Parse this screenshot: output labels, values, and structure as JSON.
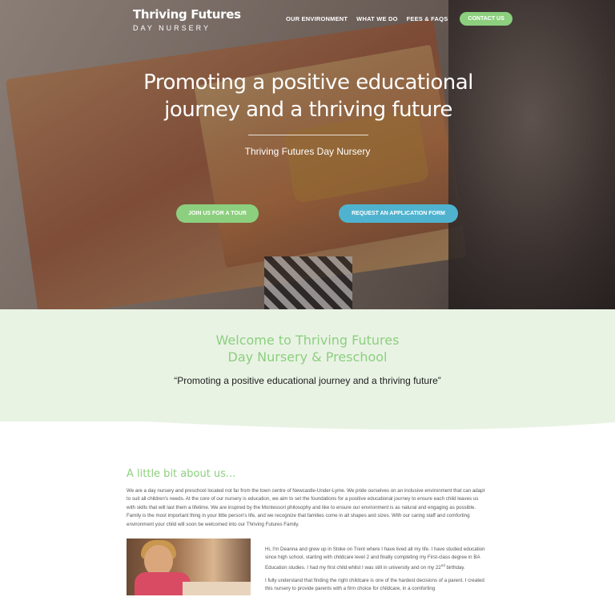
{
  "brand": {
    "name": "Thriving Futures",
    "tagline": "DAY NURSERY"
  },
  "nav": {
    "items": [
      "OUR ENVIRONMENT",
      "WHAT WE DO",
      "FEES & FAQS"
    ],
    "contact_label": "CONTACT US"
  },
  "hero": {
    "title_line1": "Promoting a positive educational",
    "title_line2": "journey and a thriving future",
    "subtitle": "Thriving Futures Day Nursery",
    "tour_button": "JOIN US FOR A TOUR",
    "apply_button": "REQUEST AN APPLICATION FORM"
  },
  "welcome": {
    "title_line1": "Welcome to Thriving Futures",
    "title_line2": "Day Nursery & Preschool",
    "quote": "“Promoting a positive educational journey and a thriving future”"
  },
  "about": {
    "title": "A little bit about us...",
    "body": "We are a day nursery and preschool located not far from the town centre of Newcastle-Under-Lyme. We pride ourselves on an inclusive environment that can adapt to suit all children's needs. At the core of our nursery is education, we aim to set the foundations for a positive educational journey to ensure each child leaves us with skills that will last them a lifetime. We are inspired by the Montessori philosophy and like to ensure our environment is as natural and engaging as possible. Family is the most important thing in your little person's life, and we recognize that families come in all shapes and sizes. With our caring staff and comforting environment your child will soon be welcomed into our Thriving Futures Family.",
    "bio_p1_before": "Hi, I'm Deanna and grew up in Stoke on Trent where I have lived all my life.  I have studied education since high school, starting with childcare level 2 and finally completing my First-class degree in BA Education studies. I had my first child whilst I was still in university and on my 22",
    "bio_p1_sup": "nd",
    "bio_p1_after": " birthday.",
    "bio_p2": "I fully understand that finding the right childcare is one of the hardest decisions of a parent. I created this nursery to provide parents with a firm choice for childcare, in a comforting"
  },
  "colors": {
    "accent_green": "#8ccf7e",
    "accent_blue": "#4fb3cf",
    "welcome_bg": "#e9f3e4"
  }
}
